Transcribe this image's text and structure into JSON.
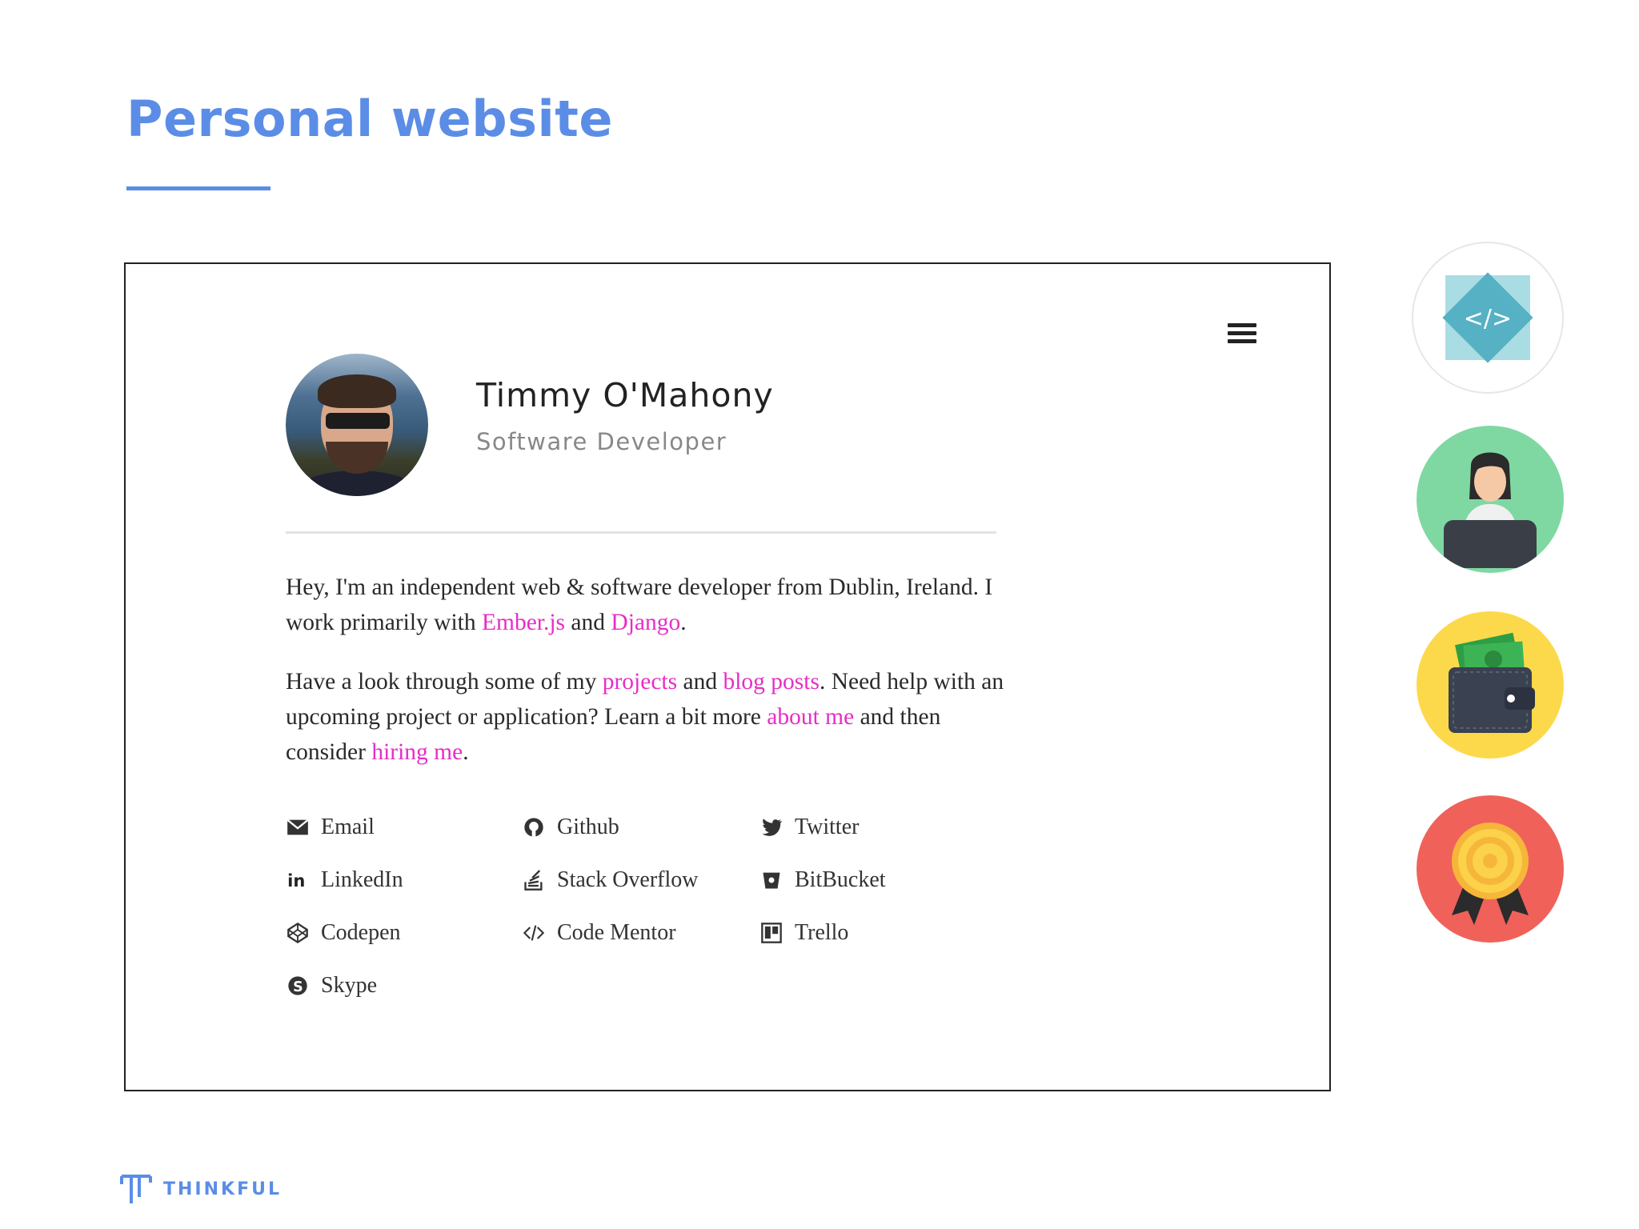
{
  "slide": {
    "title": "Personal website",
    "accent_color": "#5b8de6",
    "brand": "THINKFUL"
  },
  "profile": {
    "name": "Timmy O'Mahony",
    "role": "Software Developer",
    "menu_icon": "hamburger-menu-icon"
  },
  "bio": {
    "p1": {
      "t1": "Hey, I'm an independent web & software developer from Dublin, Ireland. I work primarily with ",
      "link1": "Ember.js",
      "t2": " and ",
      "link2": "Django",
      "t3": "."
    },
    "p2": {
      "t1": "Have a look through some of my ",
      "link1": "projects",
      "t2": " and ",
      "link2": "blog posts",
      "t3": ". Need help with an upcoming project or application? Learn a bit more ",
      "link3": "about me",
      "t4": " and then consider ",
      "link4": "hiring me",
      "t5": "."
    },
    "link_color": "#e62ec6"
  },
  "links": {
    "email": "Email",
    "github": "Github",
    "twitter": "Twitter",
    "linkedin": "LinkedIn",
    "stackoverflow": "Stack Overflow",
    "bitbucket": "BitBucket",
    "codepen": "Codepen",
    "codementor": "Code Mentor",
    "trello": "Trello",
    "skype": "Skype"
  },
  "side_icons": [
    "code-icon",
    "developer-icon",
    "wallet-icon",
    "award-icon"
  ]
}
